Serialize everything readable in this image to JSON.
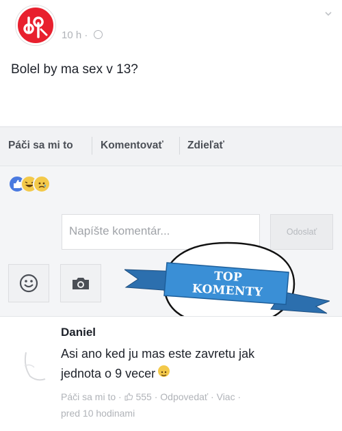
{
  "post": {
    "time": "10 h",
    "dot": "·",
    "text": "Bolel by ma sex v 13?"
  },
  "actions": {
    "like": "Páči sa mi to",
    "comment": "Komentovať",
    "share": "Zdieľať"
  },
  "reactions": [
    "like",
    "haha",
    "sad"
  ],
  "composer": {
    "placeholder": "Napíšte komentár...",
    "send": "Odoslať"
  },
  "overlay": {
    "badge": "TOP KOMENTY",
    "colors": {
      "ribbon": "#3a8fd6",
      "bubble": "#ffffff"
    }
  },
  "comment": {
    "author": "Daniel",
    "line1": "Asi ano ked ju mas este zavretu jak",
    "line2": "jednota o 9 vecer",
    "like_label": "Páči sa mi to",
    "sep1": " · ",
    "likes": "555",
    "sep2": " · ",
    "reply": "Odpovedať",
    "sep3": " · ",
    "more": "Viac",
    "sep4": " · ",
    "time": "pred 10 hodinami"
  },
  "colors": {
    "brand": "#e8202e",
    "like_blue": "#4a7ae0"
  }
}
